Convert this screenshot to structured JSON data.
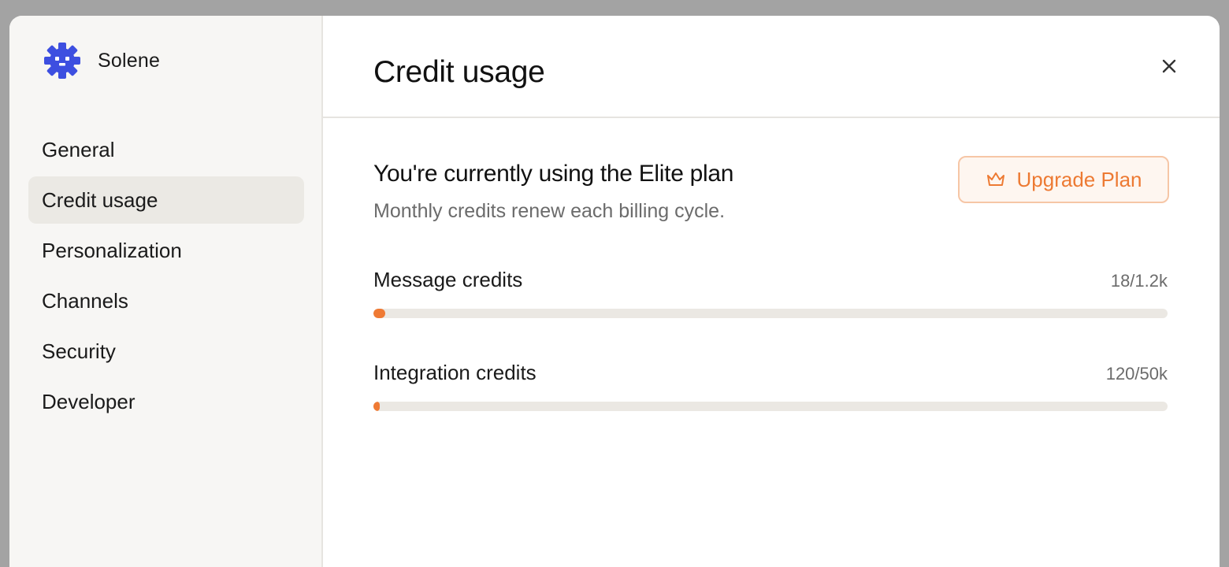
{
  "brand": {
    "name": "Solene",
    "logo_icon": "gear-face-icon",
    "logo_color": "#3d4fe0"
  },
  "sidebar": {
    "items": [
      {
        "label": "General",
        "active": false
      },
      {
        "label": "Credit usage",
        "active": true
      },
      {
        "label": "Personalization",
        "active": false
      },
      {
        "label": "Channels",
        "active": false
      },
      {
        "label": "Security",
        "active": false
      },
      {
        "label": "Developer",
        "active": false
      }
    ]
  },
  "header": {
    "title": "Credit usage",
    "close_icon": "close-icon"
  },
  "plan": {
    "heading": "You're currently using the Elite plan",
    "subtitle": "Monthly credits renew each billing cycle.",
    "upgrade_label": "Upgrade Plan",
    "upgrade_icon": "crown-icon",
    "accent_color": "#ed7a33"
  },
  "credits": [
    {
      "label": "Message credits",
      "value": "18/1.2k",
      "used": 18,
      "total": 1200
    },
    {
      "label": "Integration credits",
      "value": "120/50k",
      "used": 120,
      "total": 50000
    }
  ]
}
